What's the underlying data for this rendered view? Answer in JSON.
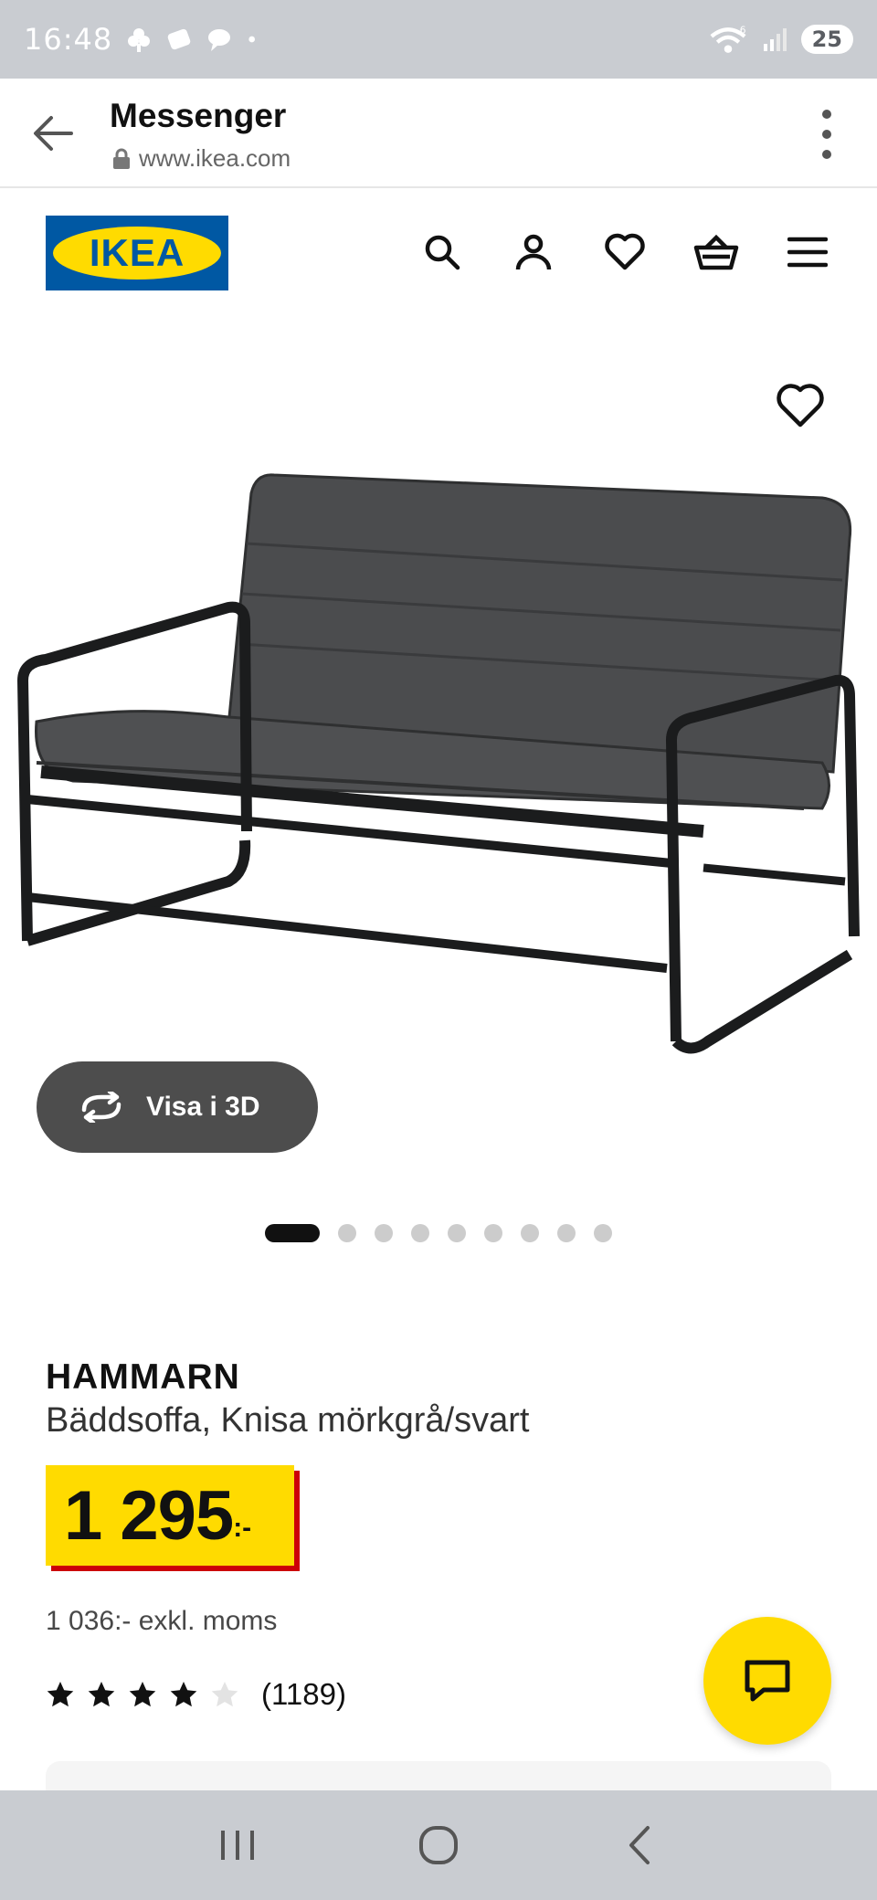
{
  "status_bar": {
    "time": "16:48",
    "battery": "25",
    "notification_icons": [
      "flower-icon",
      "stack-icon",
      "chat-bubble-icon",
      "dot-icon"
    ],
    "wifi_badge": "6"
  },
  "browser": {
    "title": "Messenger",
    "url": "www.ikea.com"
  },
  "ikea_header": {
    "logo_text": "IKEA",
    "nav_icons": [
      "search-icon",
      "user-icon",
      "heart-icon",
      "basket-icon",
      "menu-icon"
    ]
  },
  "gallery": {
    "view_3d_label": "Visa i 3D",
    "dot_count": 9,
    "active_dot": 0
  },
  "product": {
    "name": "HAMMARN",
    "description": "Bäddsoffa, Knisa mörkgrå/svart",
    "price": "1 295",
    "price_suffix": ":-",
    "price_excl_vat": "1 036:- exkl. moms",
    "rating_value": 4,
    "rating_max": 5,
    "review_count": "(1189)"
  },
  "colors": {
    "ikea_blue": "#0058a3",
    "ikea_yellow": "#ffdb00",
    "price_red": "#cc0008",
    "system_bar": "#c9ccd1"
  }
}
